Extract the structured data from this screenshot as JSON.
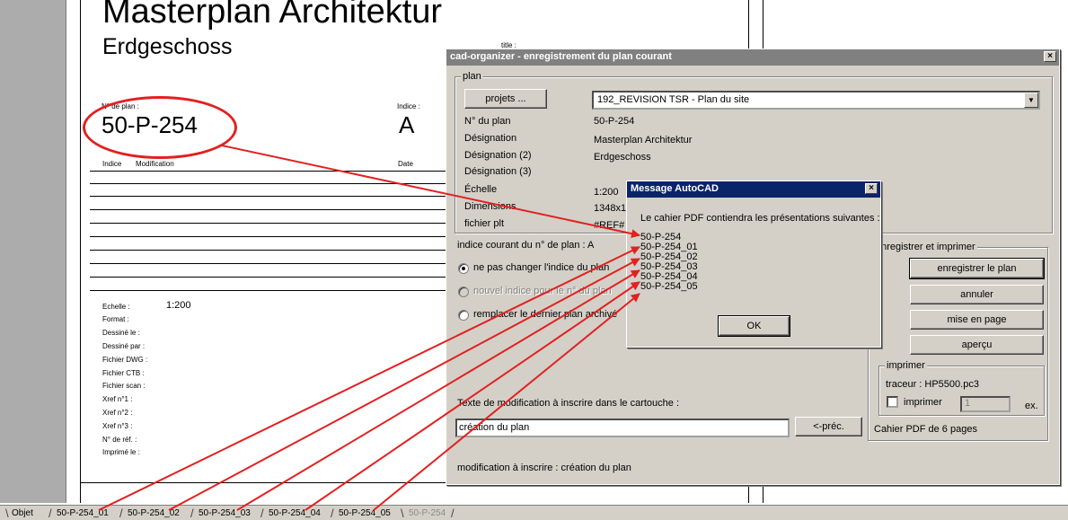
{
  "drawing": {
    "title": "Masterplan Architektur",
    "subtitle": "Erdgeschoss",
    "cropped_label": "title :",
    "plan_no_label": "N° de plan :",
    "plan_no": "50-P-254",
    "indice_label": "Indice :",
    "indice_value": "A",
    "table_col_indice": "Indice",
    "table_col_modification": "Modification",
    "table_col_date": "Date",
    "fields": [
      "Echelle :",
      "Format :",
      "Dessiné le :",
      "Dessiné par :",
      "Fichier DWG :",
      "Fichier CTB :",
      "Fichier scan :",
      "Xref n°1 :",
      "Xref n°2 :",
      "Xref n°3 :",
      "N° de réf. :",
      "Imprimé le :"
    ],
    "scale_value": "1:200",
    "highlight_color": "#e32020"
  },
  "tabs": {
    "items": [
      "Objet",
      "50-P-254_01",
      "50-P-254_02",
      "50-P-254_03",
      "50-P-254_04",
      "50-P-254_05",
      "50-P-254"
    ],
    "active_index": 6
  },
  "dialog": {
    "title": "cad-organizer - enregistrement du plan courant",
    "close_glyph": "×",
    "plan_group_label": "plan",
    "projets_button": "projets ...",
    "project_select_value": "192_REVISION   TSR - Plan du site",
    "field_labels": [
      "N° du plan",
      "Désignation",
      "Désignation (2)",
      "Désignation (3)",
      "Échelle",
      "Dimensions",
      "fichier plt"
    ],
    "field_values": [
      "50-P-254",
      "Masterplan Architektur",
      "Erdgeschoss",
      "",
      "1:200",
      "1348x1",
      "#REF#"
    ],
    "indice_courant": "indice courant du n° de plan : A",
    "radio_1": "ne pas changer l'indice du plan",
    "radio_2": "nouvel indice pour le n° du plan",
    "radio_3": "remplacer le dernier plan archivé",
    "modification_label": "Texte de modification à inscrire dans le cartouche :",
    "modification_value": "création du plan",
    "prev_button": "<-préc.",
    "modification_status": "modification à inscrire : création du plan",
    "save_group_label": "enregistrer et imprimer",
    "btn_save": "enregistrer le plan",
    "btn_cancel": "annuler",
    "btn_layout": "mise en page",
    "btn_preview": "aperçu",
    "print_group_label": "imprimer",
    "plotter": "traceur : HP5500.pc3",
    "print_checkbox_label": "imprimer",
    "copies_value": "1",
    "copies_unit": "ex.",
    "pdf_pages": "Cahier PDF de 6 pages"
  },
  "message_box": {
    "title": "Message AutoCAD",
    "close_glyph": "×",
    "text": "Le cahier PDF contiendra les présentations suivantes :",
    "items": [
      "50-P-254",
      "50-P-254_01",
      "50-P-254_02",
      "50-P-254_03",
      "50-P-254_04",
      "50-P-254_05"
    ],
    "ok_button": "OK"
  }
}
